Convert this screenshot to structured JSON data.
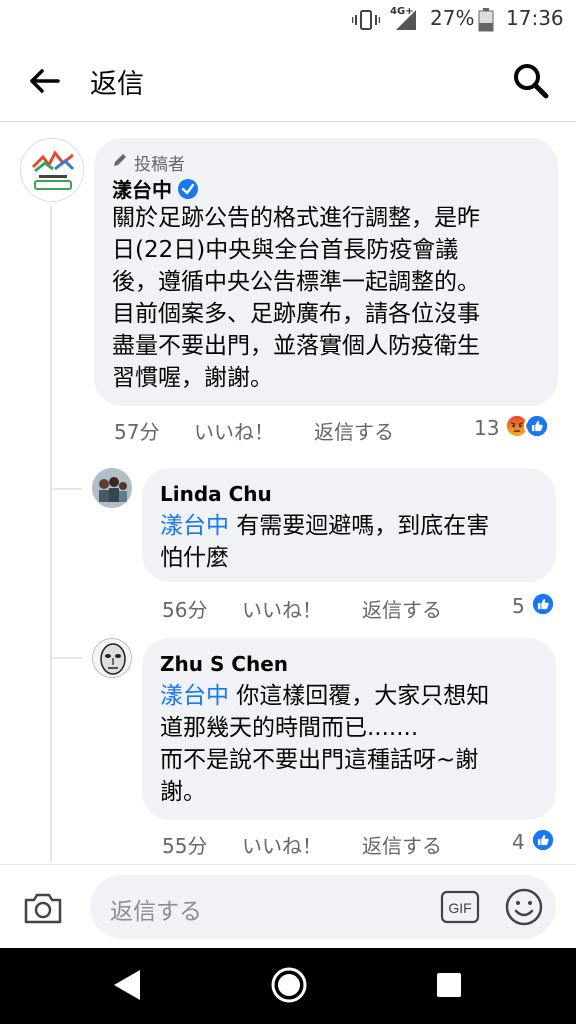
{
  "status_bar": {
    "network": "4G+",
    "battery": "27%",
    "time": "17:36"
  },
  "app_bar": {
    "title": "返信"
  },
  "main_comment": {
    "author_tag": "投稿者",
    "author": "漾台中",
    "text": "關於足跡公告的格式進行調整，是昨\n日(22日)中央與全台首長防疫會議\n後，遵循中央公告標準一起調整的。\n目前個案多、足跡廣布，請各位沒事\n盡量不要出門，並落實個人防疫衛生\n習慣喔，謝謝。",
    "time": "57分",
    "like_label": "いいね！",
    "reply_label": "返信する",
    "reaction_count": "13",
    "accent_color": "#1877f2"
  },
  "replies": [
    {
      "author": "Linda Chu",
      "mention": "漾台中",
      "text_line1": " 有需要迴避嗎，到底在害",
      "text_rest": "怕什麼",
      "time": "56分",
      "like_label": "いいね！",
      "reply_label": "返信する",
      "reaction_count": "5"
    },
    {
      "author": "Zhu S Chen",
      "mention": "漾台中",
      "text_line1": " 你這樣回覆，大家只想知",
      "text_rest": "道那幾天的時間而已.......\n而不是說不要出門這種話呀~謝\n謝。",
      "time": "55分",
      "like_label": "いいね！",
      "reply_label": "返信する",
      "reaction_count": "4"
    }
  ],
  "composer": {
    "placeholder": "返信する",
    "gif_label": "GIF"
  }
}
